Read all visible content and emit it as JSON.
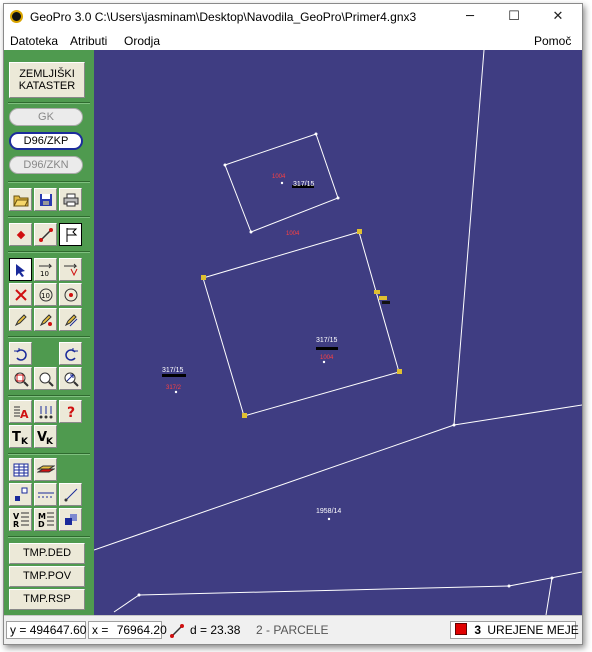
{
  "window": {
    "title": "GeoPro 3.0  C:\\Users\\jasminam\\Desktop\\Navodila_GeoPro\\Primer4.gnx3",
    "minimize_glyph": "─",
    "maximize_glyph": "☐",
    "close_glyph": "✕"
  },
  "menu": {
    "items": [
      "Datoteka",
      "Atributi",
      "Orodja"
    ],
    "help": "Pomoč"
  },
  "toolbar": {
    "header_line1": "ZEMLJIŠKI",
    "header_line2": "KATASTER",
    "coord_systems": [
      "GK",
      "D96/ZKP",
      "D96/ZKN"
    ],
    "active_coord_system": "D96/ZKP",
    "bottom_buttons": [
      "TMP.DED",
      "TMP.POV",
      "TMP.RSP"
    ]
  },
  "map": {
    "parcel_labels": [
      {
        "text": "317/15"
      },
      {
        "text": "317/15"
      },
      {
        "text": "317/15"
      },
      {
        "text": "1958/14"
      }
    ],
    "red_labels": [
      "1004",
      "1004",
      "1004",
      "317/2"
    ]
  },
  "status": {
    "y_label": "y =",
    "y_value": "494647.60",
    "x_label": "x =",
    "x_value": "76964.20",
    "d_text": "d = 23.38",
    "mode_text": "2 - PARCELE",
    "count": "3",
    "layer_text": "UREJENE MEJE",
    "layer_color": "#e00000"
  }
}
